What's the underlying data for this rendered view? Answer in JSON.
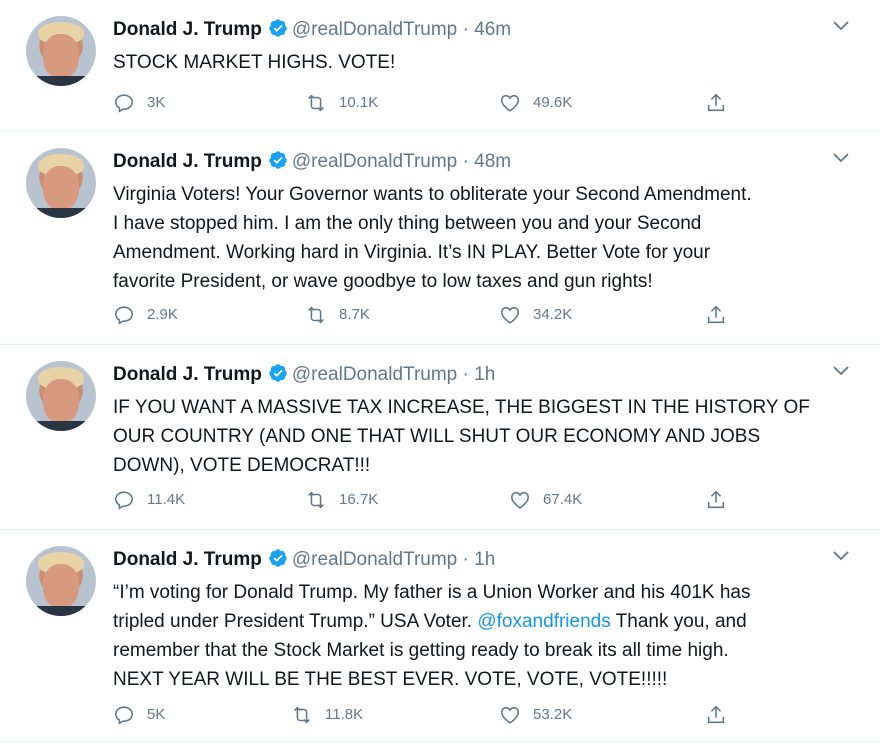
{
  "tweets": [
    {
      "name": "Donald J. Trump",
      "handle": "@realDonaldTrump",
      "separator": "·",
      "time": "46m",
      "text_parts": [
        "STOCK MARKET HIGHS. VOTE!"
      ],
      "replies": "3K",
      "retweets": "10.1K",
      "likes": "49.6K"
    },
    {
      "name": "Donald J. Trump",
      "handle": "@realDonaldTrump",
      "separator": "·",
      "time": "48m",
      "text_parts": [
        "Virginia Voters! Your Governor wants to obliterate your Second Amendment.\nI have stopped him. I am the only thing between you and your Second\nAmendment. Working hard in Virginia. It’s IN PLAY. Better Vote for your\nfavorite President, or wave goodbye to low taxes and gun rights!"
      ],
      "replies": "2.9K",
      "retweets": "8.7K",
      "likes": "34.2K"
    },
    {
      "name": "Donald J. Trump",
      "handle": "@realDonaldTrump",
      "separator": "·",
      "time": "1h",
      "text_parts": [
        "IF YOU WANT A MASSIVE TAX INCREASE, THE BIGGEST IN THE HISTORY OF\nOUR COUNTRY (AND ONE THAT WILL SHUT OUR ECONOMY AND JOBS\nDOWN), VOTE DEMOCRAT!!!"
      ],
      "replies": "11.4K",
      "retweets": "16.7K",
      "likes": "67.4K"
    },
    {
      "name": "Donald J. Trump",
      "handle": "@realDonaldTrump",
      "separator": "·",
      "time": "1h",
      "text_before": "“I’m voting for Donald Trump. My father is a Union Worker and his 401K has\ntripled under President Trump.” USA Voter. ",
      "mention": "@foxandfriends",
      "text_after": "  Thank you, and\nremember that the Stock Market is getting ready to break its all time high.\nNEXT YEAR WILL BE THE BEST EVER. VOTE, VOTE, VOTE!!!!!",
      "replies": "5K",
      "retweets": "11.8K",
      "likes": "53.2K"
    }
  ],
  "icons": {
    "verified": "verified-badge-icon",
    "reply": "reply-icon",
    "retweet": "retweet-icon",
    "like": "heart-icon",
    "share": "share-icon",
    "menu": "chevron-down-icon"
  },
  "colors": {
    "verified_blue": "#1da1f2",
    "mention_blue": "#1b95e0",
    "secondary_text": "#657786",
    "divider": "#e6ecf0"
  }
}
